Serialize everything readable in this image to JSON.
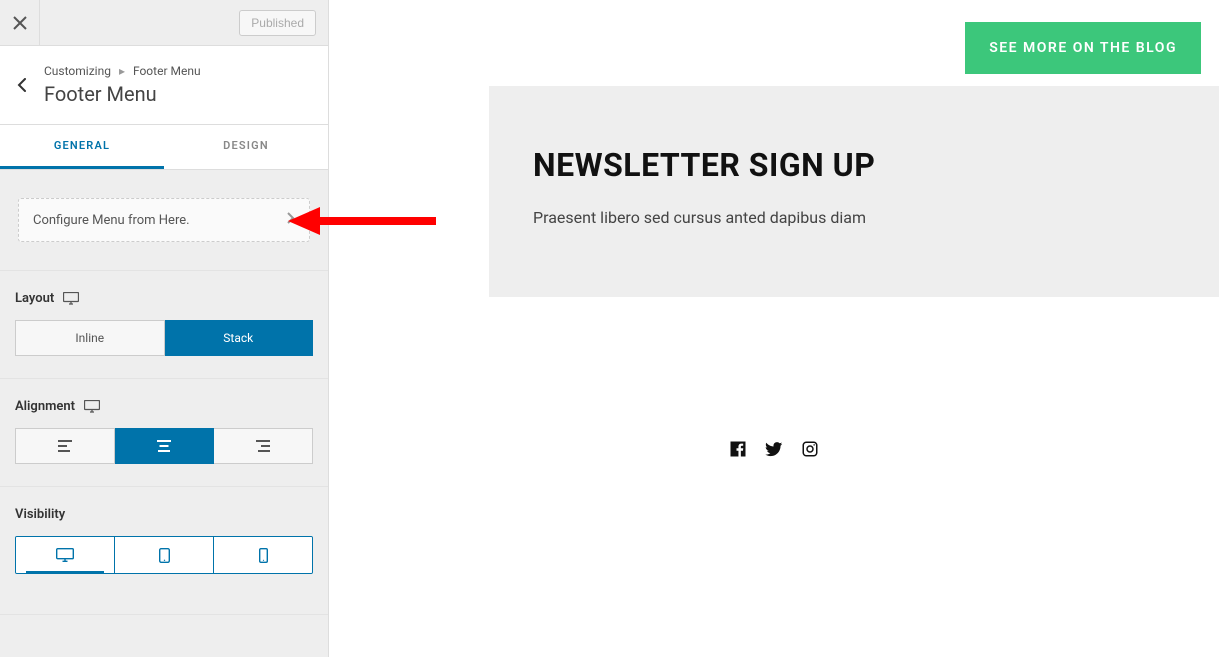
{
  "sidebar": {
    "published_label": "Published",
    "breadcrumb": {
      "root": "Customizing",
      "current": "Footer Menu"
    },
    "title": "Footer Menu",
    "tabs": {
      "general": "General",
      "design": "Design"
    },
    "configure_text": "Configure Menu from Here.",
    "layout": {
      "label": "Layout",
      "options": {
        "inline": "Inline",
        "stack": "Stack"
      }
    },
    "alignment": {
      "label": "Alignment"
    },
    "visibility": {
      "label": "Visibility"
    }
  },
  "preview": {
    "blog_button": "SEE MORE ON THE BLOG",
    "newsletter": {
      "title": "NEWSLETTER SIGN UP",
      "description": "Praesent libero sed cursus anted dapibus diam"
    }
  }
}
